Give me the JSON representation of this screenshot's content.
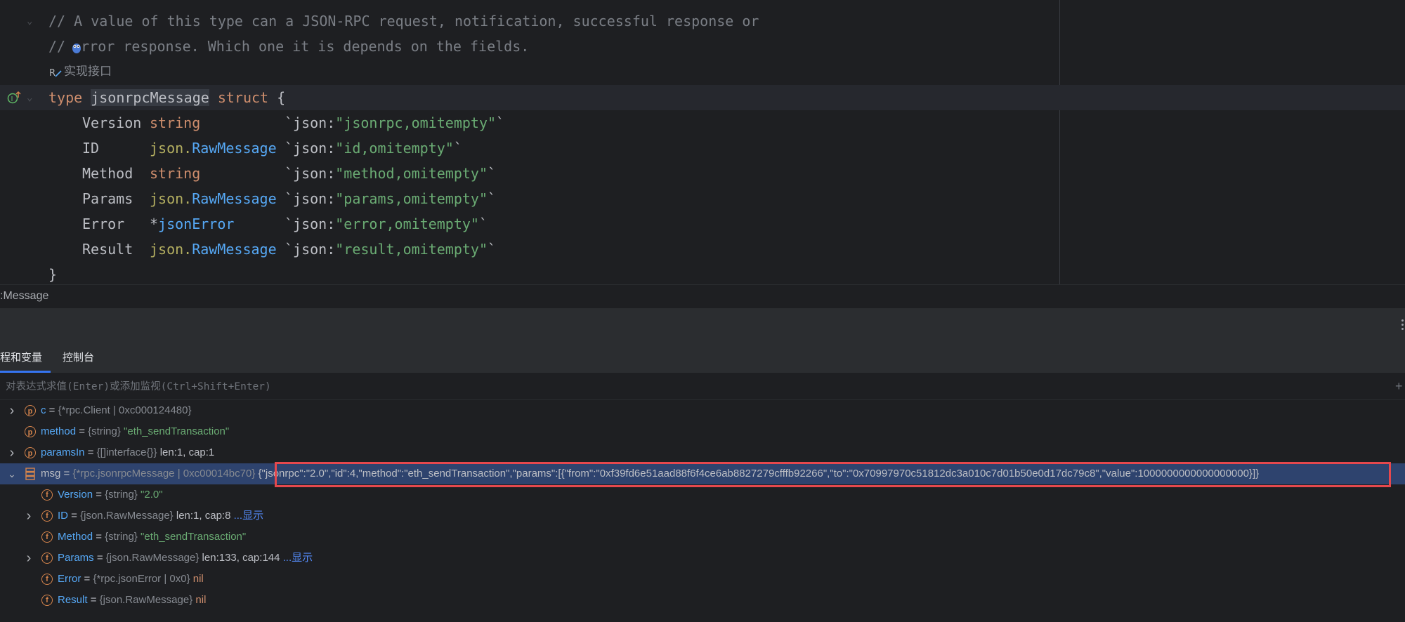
{
  "editor": {
    "comment_line1": "// A value of this type can a JSON-RPC request, notification, successful response or",
    "comment_line2_prefix": "// ",
    "comment_line2_suffix": "rror response. Which one it is depends on the fields.",
    "inlay_hint": "实现接口",
    "struct_decl": {
      "kw_type": "type",
      "name": "jsonrpcMessage",
      "kw_struct": "struct",
      "open_brace": "{"
    },
    "fields": [
      {
        "name": "Version",
        "pkg": "",
        "type": "string",
        "tag_key": "`json:",
        "tag_val": "\"jsonrpc,omitempty\"",
        "tag_end": "`",
        "type_kind": "builtin"
      },
      {
        "name": "ID",
        "pkg": "json.",
        "type": "RawMessage",
        "tag_key": "`json:",
        "tag_val": "\"id,omitempty\"",
        "tag_end": "`",
        "type_kind": "pkg"
      },
      {
        "name": "Method",
        "pkg": "",
        "type": "string",
        "tag_key": "`json:",
        "tag_val": "\"method,omitempty\"",
        "tag_end": "`",
        "type_kind": "builtin"
      },
      {
        "name": "Params",
        "pkg": "json.",
        "type": "RawMessage",
        "tag_key": "`json:",
        "tag_val": "\"params,omitempty\"",
        "tag_end": "`",
        "type_kind": "pkg"
      },
      {
        "name": "Error",
        "pkg": "*",
        "type": "jsonError",
        "tag_key": "`json:",
        "tag_val": "\"error,omitempty\"",
        "tag_end": "`",
        "type_kind": "ptr"
      },
      {
        "name": "Result",
        "pkg": "json.",
        "type": "RawMessage",
        "tag_key": "`json:",
        "tag_val": "\"result,omitempty\"",
        "tag_end": "`",
        "type_kind": "pkg"
      }
    ],
    "close_brace": "}"
  },
  "breadcrumb": ":Message",
  "debug_tabs": [
    {
      "label": "程和变量",
      "active": true
    },
    {
      "label": "控制台",
      "active": false
    }
  ],
  "eval_placeholder": "对表达式求值(Enter)或添加监视(Ctrl+Shift+Enter)",
  "variables": [
    {
      "name": "c",
      "eq": " = ",
      "type": "{*rpc.Client | 0xc000124480}",
      "value": "",
      "badge": "p",
      "expandable": true,
      "expanded": false
    },
    {
      "name": "method",
      "eq": " = ",
      "type": "{string} ",
      "value": "\"eth_sendTransaction\"",
      "badge": "p",
      "expandable": false
    },
    {
      "name": "paramsIn",
      "eq": " = ",
      "type": "{[]interface{}} ",
      "value": "len:1, cap:1",
      "badge": "p",
      "expandable": true,
      "expanded": false
    },
    {
      "name": "msg",
      "eq": " = ",
      "type": "{*rpc.jsonrpcMessage | 0xc00014bc70}",
      "value": " {\"jsonrpc\":\"2.0\",\"id\":4,\"method\":\"eth_sendTransaction\",\"params\":[{\"from\":\"0xf39fd6e51aad88f6f4ce6ab8827279cfffb92266\",\"to\":\"0x70997970c51812dc3a010c7d01b50e0d17dc79c8\",\"value\":1000000000000000000}]}",
      "badge": "stack",
      "expandable": true,
      "expanded": true,
      "selected": true
    },
    {
      "name": "Version",
      "eq": " = ",
      "type": "{string} ",
      "value": "\"2.0\"",
      "badge": "f",
      "expandable": false
    },
    {
      "name": "ID",
      "eq": " = ",
      "type": "{json.RawMessage} ",
      "value": "len:1, cap:8 ",
      "link": "...显示",
      "badge": "f",
      "expandable": true,
      "expanded": false
    },
    {
      "name": "Method",
      "eq": " = ",
      "type": "{string} ",
      "value": "\"eth_sendTransaction\"",
      "badge": "f",
      "expandable": false
    },
    {
      "name": "Params",
      "eq": " = ",
      "type": "{json.RawMessage} ",
      "value": "len:133, cap:144 ",
      "link": "...显示",
      "badge": "f",
      "expandable": true,
      "expanded": false
    },
    {
      "name": "Error",
      "eq": " = ",
      "type": "{*rpc.jsonError | 0x0} ",
      "value": "nil",
      "badge": "f",
      "expandable": false
    },
    {
      "name": "Result",
      "eq": " = ",
      "type": "{json.RawMessage} ",
      "value": "nil",
      "badge": "f",
      "expandable": false
    }
  ],
  "colors": {
    "accent": "#3574f0",
    "selection_row": "#2e436e",
    "highlight_box": "#e5484d",
    "keyword": "#cf8e6d",
    "string": "#6aab73",
    "identifier_blue": "#56a8f5"
  }
}
